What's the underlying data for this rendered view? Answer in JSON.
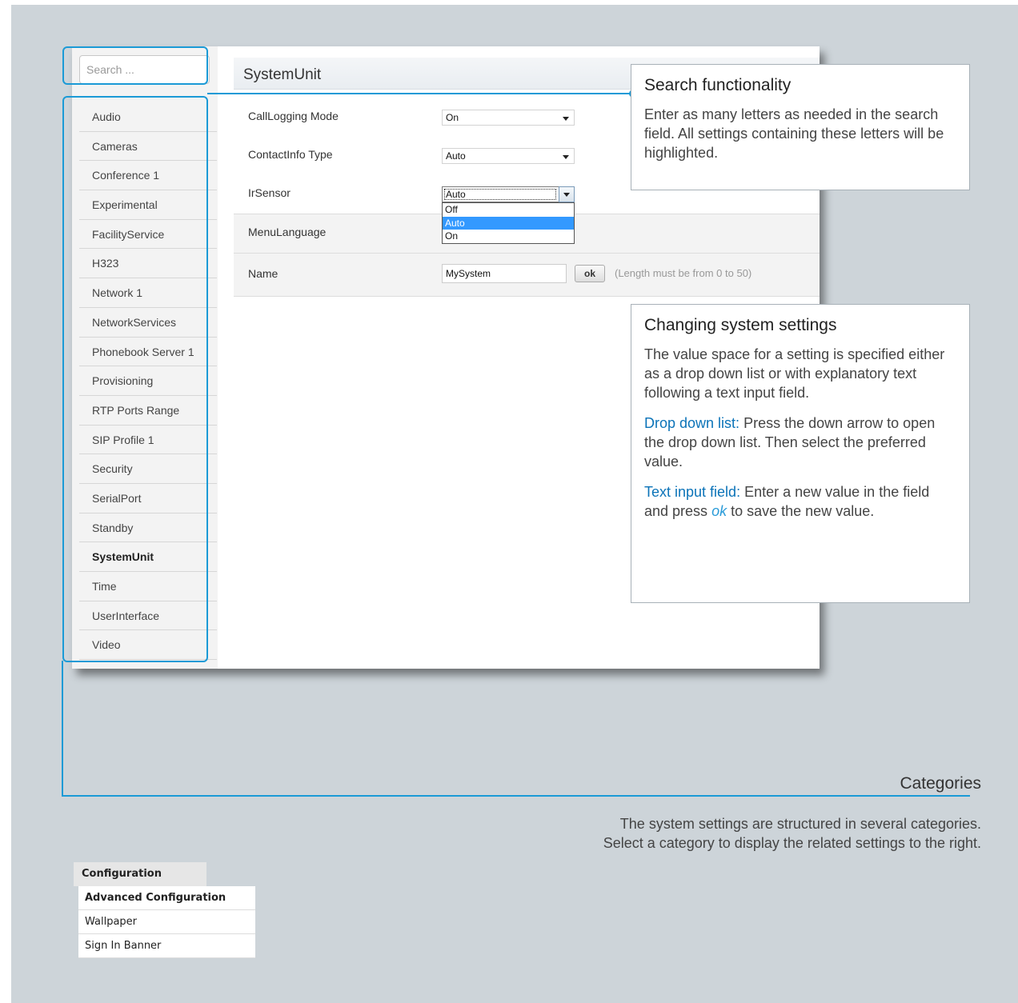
{
  "search": {
    "placeholder": "Search ..."
  },
  "sidebar": {
    "items": [
      {
        "label": "Audio"
      },
      {
        "label": "Cameras"
      },
      {
        "label": "Conference 1"
      },
      {
        "label": "Experimental"
      },
      {
        "label": "FacilityService"
      },
      {
        "label": "H323"
      },
      {
        "label": "Network 1"
      },
      {
        "label": "NetworkServices"
      },
      {
        "label": "Phonebook Server 1"
      },
      {
        "label": "Provisioning"
      },
      {
        "label": "RTP Ports Range"
      },
      {
        "label": "SIP Profile 1"
      },
      {
        "label": "Security"
      },
      {
        "label": "SerialPort"
      },
      {
        "label": "Standby"
      },
      {
        "label": "SystemUnit",
        "active": true
      },
      {
        "label": "Time"
      },
      {
        "label": "UserInterface"
      },
      {
        "label": "Video"
      }
    ]
  },
  "main": {
    "title": "SystemUnit",
    "settings": {
      "call_logging": {
        "label": "CallLogging Mode",
        "value": "On"
      },
      "contact_info": {
        "label": "ContactInfo Type",
        "value": "Auto"
      },
      "ir_sensor": {
        "label": "IrSensor",
        "value": "Auto",
        "options": [
          "Off",
          "Auto",
          "On"
        ],
        "selected": "Auto"
      },
      "menu_language": {
        "label": "MenuLanguage"
      },
      "name": {
        "label": "Name",
        "value": "MySystem",
        "button": "ok",
        "hint": "(Length must be from 0 to 50)"
      }
    }
  },
  "callouts": {
    "search": {
      "title": "Search functionality",
      "text": "Enter as many letters as needed in the search field. All settings containing these letters will be highlighted."
    },
    "settings": {
      "title": "Changing system settings",
      "intro": "The value space for a setting is specified either as a drop down list or with explanatory text following a text input field.",
      "dropdown_label": "Drop down list:",
      "dropdown_text": "Press the down arrow to open the drop down list. Then select the preferred value.",
      "text_label": "Text input field:",
      "text_text_before": "Enter a new value in the field and press",
      "text_ok": "ok",
      "text_text_after": "to save the new value."
    },
    "categories": {
      "title": "Categories",
      "text_line1": "The system settings are structured in several categories.",
      "text_line2": "Select a category to display the related settings to the right."
    }
  },
  "bottom_nav": {
    "header": "Configuration",
    "items": [
      "Advanced Configuration",
      "Wallpaper",
      "Sign In Banner"
    ]
  },
  "colors": {
    "accent": "#1b9ad6",
    "background": "#cdd4d9",
    "dropdown_selected": "#3399ff"
  }
}
